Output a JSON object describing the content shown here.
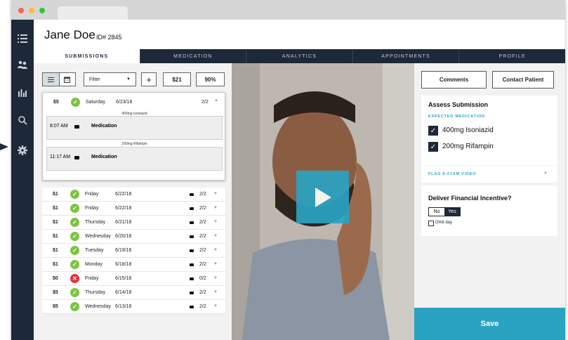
{
  "colors": {
    "accent": "#2aa3c2",
    "navy": "#1d2838",
    "ok": "#7cc540",
    "fail": "#e5323c"
  },
  "sidebar": {
    "icons": [
      "menu-list-icon",
      "users-icon",
      "bar-chart-icon",
      "search-icon",
      "gear-icon"
    ]
  },
  "patient": {
    "name": "Jane Doe",
    "id": "ID# 2845"
  },
  "nav": {
    "tabs": [
      "SUBMISSIONS",
      "MEDICATION",
      "ANALYTICS",
      "APPOINTMENTS",
      "PROFILE"
    ]
  },
  "toolbar": {
    "filter": "Filter",
    "add": "+",
    "amount": "$21",
    "percent": "90%"
  },
  "expanded": {
    "amount": "$5",
    "day": "Saturday",
    "date": "6/23/18",
    "count": "2/2",
    "meds": [
      {
        "label": "400mg Isoniazid",
        "time": "8:07 AM",
        "title": "Medication"
      },
      {
        "label": "200mg Rifampin",
        "time": "11:17 AM",
        "title": "Medication"
      }
    ]
  },
  "submissions": [
    {
      "amount": "$1",
      "status": "ok",
      "day": "Friday",
      "date": "6/22/18",
      "count": "2/2"
    },
    {
      "amount": "$1",
      "status": "ok",
      "day": "Friday",
      "date": "6/22/18",
      "count": "2/2"
    },
    {
      "amount": "$1",
      "status": "ok",
      "day": "Thursday",
      "date": "6/21/18",
      "count": "2/2"
    },
    {
      "amount": "$1",
      "status": "ok",
      "day": "Wednesday",
      "date": "6/20/18",
      "count": "2/2"
    },
    {
      "amount": "$1",
      "status": "ok",
      "day": "Tuesday",
      "date": "6/19/18",
      "count": "2/2"
    },
    {
      "amount": "$1",
      "status": "ok",
      "day": "Monday",
      "date": "6/18/18",
      "count": "2/2"
    },
    {
      "amount": "$0",
      "status": "fail",
      "day": "Friday",
      "date": "6/15/18",
      "count": "0/2"
    },
    {
      "amount": "$5",
      "status": "ok",
      "day": "Thursday",
      "date": "6/14/18",
      "count": "2/2"
    },
    {
      "amount": "$5",
      "status": "ok",
      "day": "Wednesday",
      "date": "6/13/18",
      "count": "2/2"
    }
  ],
  "right": {
    "comments": "Comments",
    "contact": "Contact Patient",
    "assess_title": "Assess Submission",
    "expected_label": "EXPECTED MEDICATION",
    "meds": [
      "400mg Isoniazid",
      "200mg Rifampin"
    ],
    "flag": "FLAG 8:07AM VIDEO",
    "incentive_title": "Deliver Financial Incentive?",
    "no": "No",
    "yes": "Yes",
    "omit": "Omit day",
    "save": "Save"
  }
}
